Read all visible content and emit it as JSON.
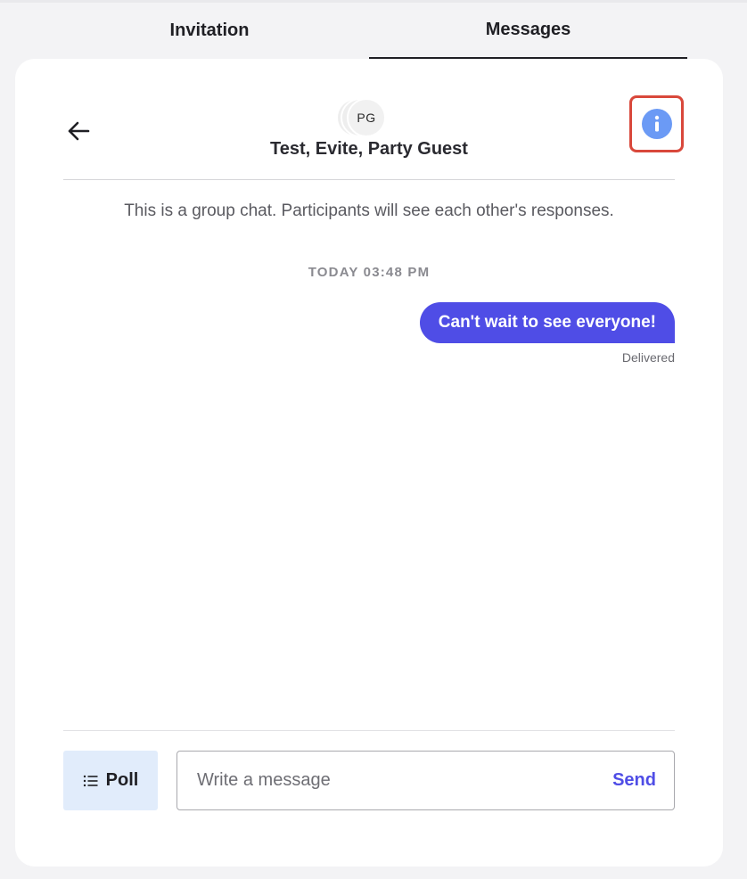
{
  "tabs": [
    {
      "label": "Invitation",
      "active": false
    },
    {
      "label": "Messages",
      "active": true
    }
  ],
  "chat": {
    "avatar_initials": "PG",
    "title": "Test, Evite, Party Guest",
    "group_note": "This is a group chat. Participants will see each other's responses.",
    "timestamp": "TODAY 03:48 PM",
    "messages": [
      {
        "text": "Can't wait to see everyone!",
        "status": "Delivered",
        "outgoing": true
      }
    ]
  },
  "composer": {
    "poll_label": "Poll",
    "placeholder": "Write a message",
    "send_label": "Send"
  },
  "colors": {
    "accent": "#4f4de6",
    "info_icon": "#6b9af5",
    "highlight_border": "#d9483b",
    "poll_bg": "#e1ecfb"
  },
  "icons": {
    "back": "arrow-left-icon",
    "info": "info-icon",
    "poll": "list-icon"
  }
}
